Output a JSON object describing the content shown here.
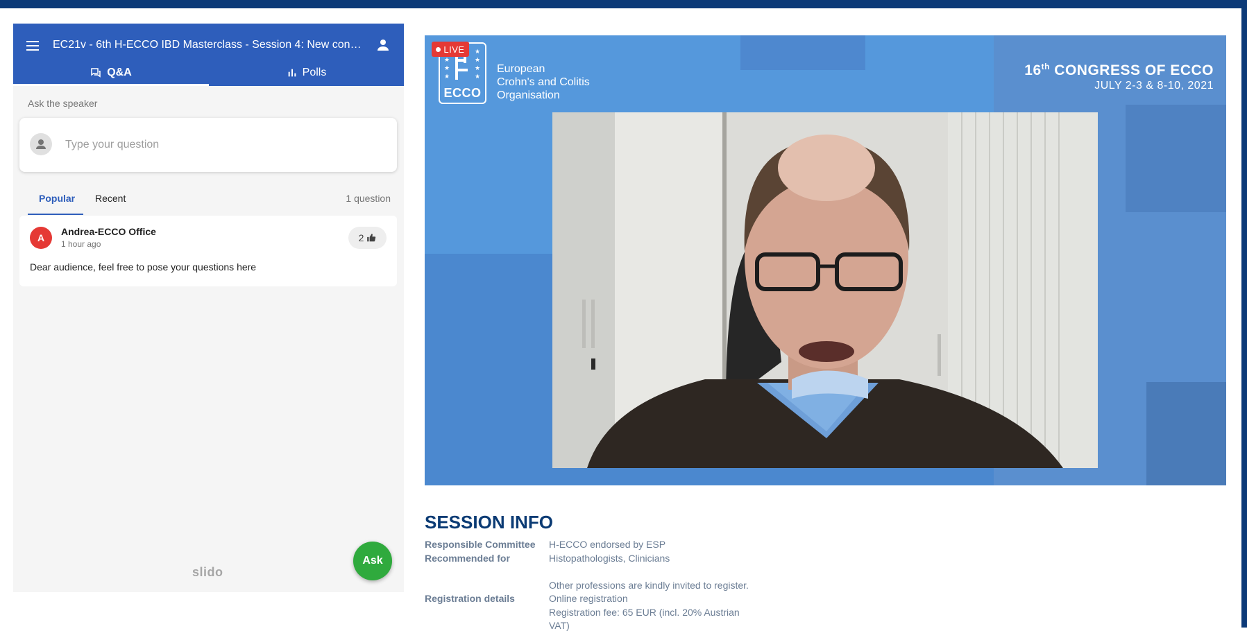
{
  "slido": {
    "event_title": "EC21v - 6th H-ECCO IBD Masterclass - Session 4: New conce...",
    "tabs": [
      {
        "label": "Q&A",
        "icon": "chat-bubbles-icon",
        "active": true
      },
      {
        "label": "Polls",
        "icon": "bar-chart-icon",
        "active": false
      }
    ],
    "ask_label": "Ask the speaker",
    "question_placeholder": "Type your question",
    "sort_tabs": [
      {
        "label": "Popular",
        "active": true
      },
      {
        "label": "Recent",
        "active": false
      }
    ],
    "question_count": "1 question",
    "questions": [
      {
        "avatar_letter": "A",
        "author": "Andrea-ECCO Office",
        "time": "1 hour ago",
        "likes": "2",
        "text": "Dear audience, feel free to pose your questions here"
      }
    ],
    "brand": "slido",
    "ask_button": "Ask"
  },
  "video": {
    "live_badge": "LIVE",
    "logo_text": "ECCO",
    "org_name_lines": [
      "European",
      "Crohn's and Colitis",
      "Organisation"
    ],
    "congress_number": "16",
    "congress_suffix": "th",
    "congress_title": "CONGRESS OF ECCO",
    "congress_dates": "JULY 2-3 & 8-10, 2021"
  },
  "session_info": {
    "heading": "SESSION INFO",
    "rows": [
      {
        "label": "Responsible Committee",
        "value": "H-ECCO endorsed by ESP"
      },
      {
        "label": "Recommended for",
        "value": "Histopathologists, Clinicians"
      },
      {
        "label": "Registration details",
        "value_lines": [
          "Other professions are kindly invited to register.",
          "Online registration",
          "Registration fee: 65 EUR (incl. 20% Austrian",
          "VAT)"
        ]
      }
    ]
  },
  "colors": {
    "header_blue": "#2e5ebb",
    "navy": "#0b3b74",
    "live_red": "#e53935",
    "ask_green": "#2faa3d",
    "video_blue": "#4f8ed7"
  }
}
